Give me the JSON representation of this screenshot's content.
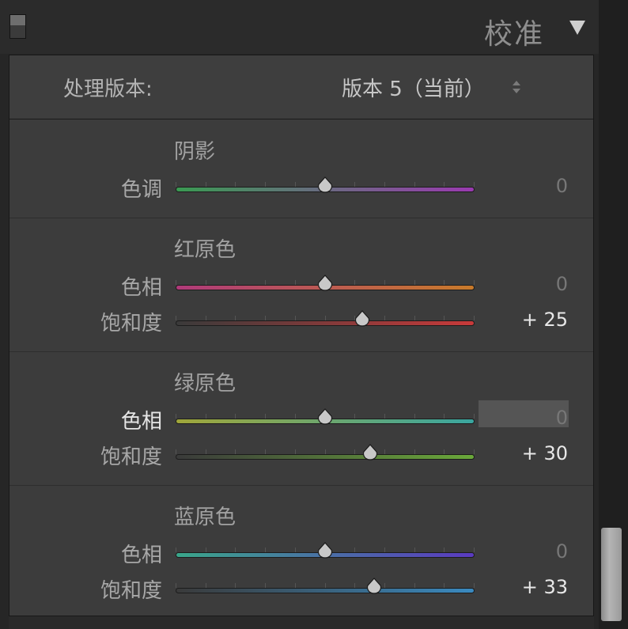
{
  "header": {
    "title": "校准",
    "collapse_icon": "triangle-down-icon"
  },
  "process": {
    "label": "处理版本:",
    "value": "版本 5（当前）"
  },
  "sections": [
    {
      "title": "阴影",
      "rows": [
        {
          "label": "色调",
          "value": "0",
          "numeric": 0,
          "gradient": [
            "#3a9a52",
            "#9a3ab0"
          ],
          "active": false
        }
      ]
    },
    {
      "title": "红原色",
      "rows": [
        {
          "label": "色相",
          "value": "0",
          "numeric": 0,
          "gradient": [
            "#b03a7a",
            "#c87a2a"
          ],
          "active": false
        },
        {
          "label": "饱和度",
          "value": "+ 25",
          "numeric": 25,
          "gradient": [
            "#3a3a3a",
            "#c83a3a"
          ],
          "active": false
        }
      ]
    },
    {
      "title": "绿原色",
      "rows": [
        {
          "label": "色相",
          "value": "0",
          "numeric": 0,
          "gradient": [
            "#a0a63a",
            "#3aa6a0"
          ],
          "active": true
        },
        {
          "label": "饱和度",
          "value": "+ 30",
          "numeric": 30,
          "gradient": [
            "#3a3a3a",
            "#6aa83a"
          ],
          "active": false
        }
      ]
    },
    {
      "title": "蓝原色",
      "rows": [
        {
          "label": "色相",
          "value": "0",
          "numeric": 0,
          "gradient": [
            "#3aa68a",
            "#5a3ac0"
          ],
          "active": false
        },
        {
          "label": "饱和度",
          "value": "+ 33",
          "numeric": 33,
          "gradient": [
            "#3a3a3a",
            "#3a8ac0"
          ],
          "active": false
        }
      ]
    }
  ]
}
